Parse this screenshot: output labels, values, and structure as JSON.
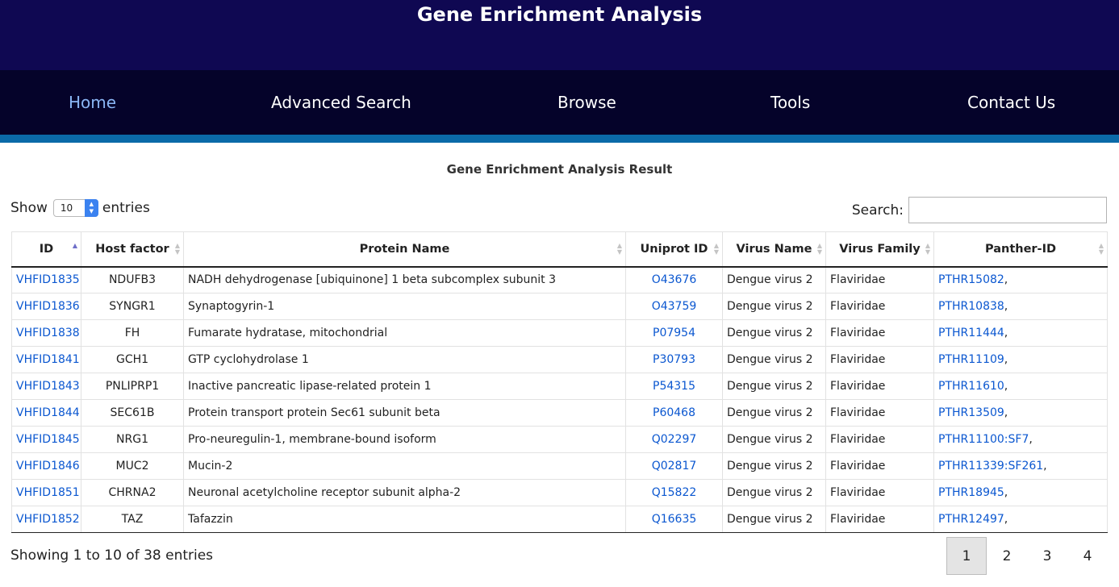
{
  "header": {
    "title": "Gene Enrichment Analysis"
  },
  "nav": [
    {
      "label": "Home",
      "active": true
    },
    {
      "label": "Advanced Search",
      "active": false
    },
    {
      "label": "Browse",
      "active": false
    },
    {
      "label": "Tools",
      "active": false
    },
    {
      "label": "Contact Us",
      "active": false
    }
  ],
  "result": {
    "title": "Gene Enrichment Analysis Result"
  },
  "length": {
    "show_label": "Show",
    "value": "10",
    "entries_label": "entries"
  },
  "search": {
    "label": "Search:",
    "value": ""
  },
  "table": {
    "columns": [
      "ID",
      "Host factor",
      "Protein Name",
      "Uniprot ID",
      "Virus Name",
      "Virus Family",
      "Panther-ID"
    ],
    "rows": [
      {
        "id": "VHFID1835",
        "host": "NDUFB3",
        "protein": "NADH dehydrogenase [ubiquinone] 1 beta subcomplex subunit 3",
        "uniprot": "O43676",
        "virus": "Dengue virus 2",
        "family": "Flaviridae",
        "panther": "PTHR15082"
      },
      {
        "id": "VHFID1836",
        "host": "SYNGR1",
        "protein": "Synaptogyrin-1",
        "uniprot": "O43759",
        "virus": "Dengue virus 2",
        "family": "Flaviridae",
        "panther": "PTHR10838"
      },
      {
        "id": "VHFID1838",
        "host": "FH",
        "protein": "Fumarate hydratase, mitochondrial",
        "uniprot": "P07954",
        "virus": "Dengue virus 2",
        "family": "Flaviridae",
        "panther": "PTHR11444"
      },
      {
        "id": "VHFID1841",
        "host": "GCH1",
        "protein": "GTP cyclohydrolase 1",
        "uniprot": "P30793",
        "virus": "Dengue virus 2",
        "family": "Flaviridae",
        "panther": "PTHR11109"
      },
      {
        "id": "VHFID1843",
        "host": "PNLIPRP1",
        "protein": "Inactive pancreatic lipase-related protein 1",
        "uniprot": "P54315",
        "virus": "Dengue virus 2",
        "family": "Flaviridae",
        "panther": "PTHR11610"
      },
      {
        "id": "VHFID1844",
        "host": "SEC61B",
        "protein": "Protein transport protein Sec61 subunit beta",
        "uniprot": "P60468",
        "virus": "Dengue virus 2",
        "family": "Flaviridae",
        "panther": "PTHR13509"
      },
      {
        "id": "VHFID1845",
        "host": "NRG1",
        "protein": "Pro-neuregulin-1, membrane-bound isoform",
        "uniprot": "Q02297",
        "virus": "Dengue virus 2",
        "family": "Flaviridae",
        "panther": "PTHR11100:SF7"
      },
      {
        "id": "VHFID1846",
        "host": "MUC2",
        "protein": "Mucin-2",
        "uniprot": "Q02817",
        "virus": "Dengue virus 2",
        "family": "Flaviridae",
        "panther": "PTHR11339:SF261"
      },
      {
        "id": "VHFID1851",
        "host": "CHRNA2",
        "protein": "Neuronal acetylcholine receptor subunit alpha-2",
        "uniprot": "Q15822",
        "virus": "Dengue virus 2",
        "family": "Flaviridae",
        "panther": "PTHR18945"
      },
      {
        "id": "VHFID1852",
        "host": "TAZ",
        "protein": "Tafazzin",
        "uniprot": "Q16635",
        "virus": "Dengue virus 2",
        "family": "Flaviridae",
        "panther": "PTHR12497"
      }
    ]
  },
  "info": "Showing 1 to 10 of 38 entries",
  "pagination": {
    "pages": [
      "1",
      "2",
      "3",
      "4"
    ],
    "current": "1"
  },
  "colors": {
    "header_bg": "#0f0852",
    "nav_bg": "#05032a",
    "accent": "#0b6aa8",
    "link": "#0b57d0",
    "nav_active": "#8ab6f5"
  },
  "icons": {
    "sort_indicator": "sort-arrows-icon",
    "select_arrows": "updown-arrows-icon"
  }
}
